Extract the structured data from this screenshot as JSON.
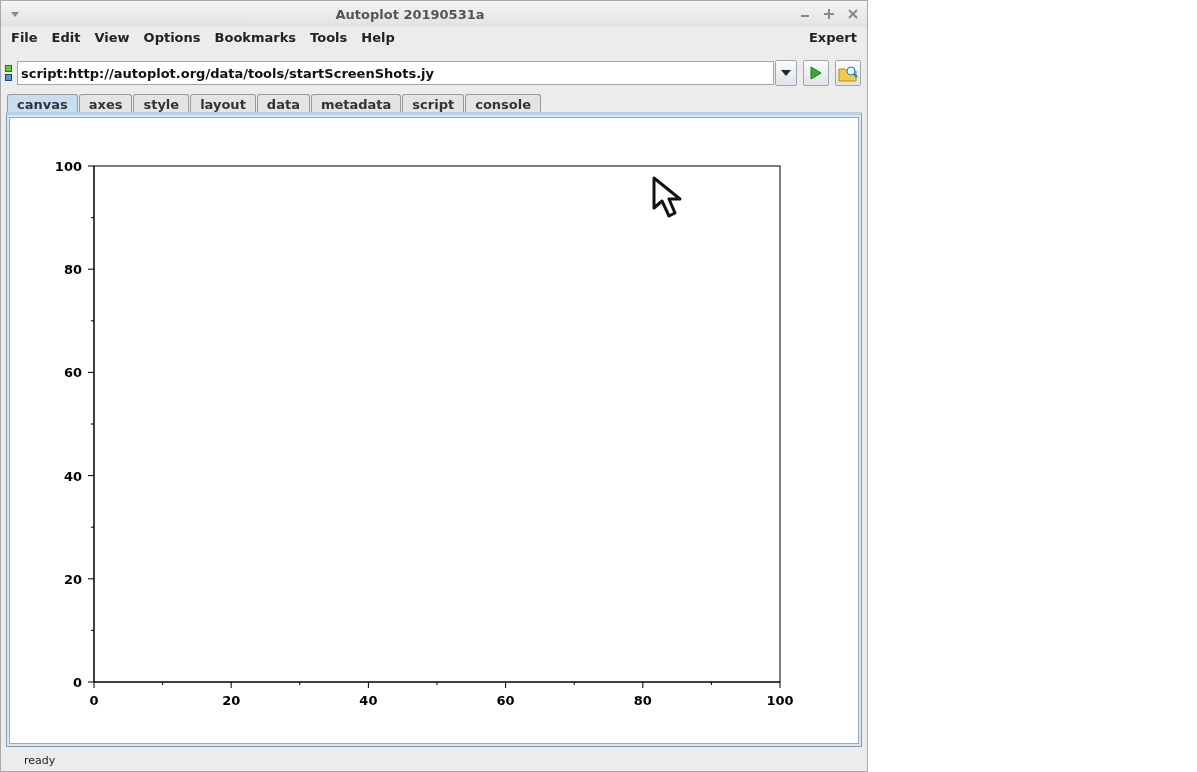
{
  "window": {
    "title": "Autoplot 20190531a"
  },
  "menu": {
    "items": [
      "File",
      "Edit",
      "View",
      "Options",
      "Bookmarks",
      "Tools",
      "Help"
    ],
    "right": "Expert"
  },
  "address": {
    "value": "script:http://autoplot.org/data/tools/startScreenShots.jy"
  },
  "tabs": [
    {
      "label": "canvas",
      "selected": true
    },
    {
      "label": "axes",
      "selected": false
    },
    {
      "label": "style",
      "selected": false
    },
    {
      "label": "layout",
      "selected": false
    },
    {
      "label": "data",
      "selected": false
    },
    {
      "label": "metadata",
      "selected": false
    },
    {
      "label": "script",
      "selected": false
    },
    {
      "label": "console",
      "selected": false
    }
  ],
  "plot": {
    "chart_data": {
      "type": "line",
      "xlim": [
        0,
        100
      ],
      "ylim": [
        0,
        100
      ],
      "xticks": [
        0,
        20,
        40,
        60,
        80,
        100
      ],
      "yticks": [
        0,
        20,
        40,
        60,
        80,
        100
      ]
    }
  },
  "status_bar": "ready"
}
